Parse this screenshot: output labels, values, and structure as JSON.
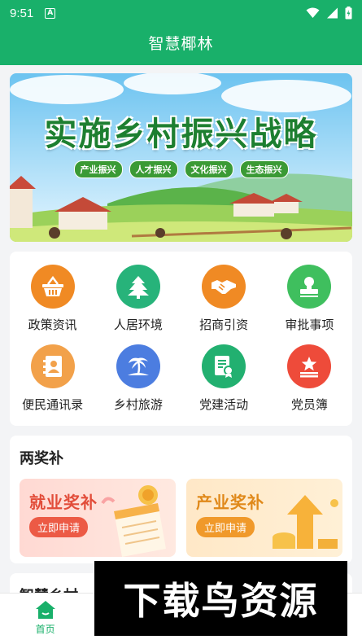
{
  "status": {
    "time": "9:51",
    "badge": "A"
  },
  "header": {
    "title": "智慧椰林"
  },
  "banner": {
    "title": "实施乡村振兴战略",
    "pills": [
      "产业振兴",
      "人才振兴",
      "文化振兴",
      "生态振兴"
    ]
  },
  "grid": {
    "items": [
      {
        "label": "政策资讯",
        "icon": "basket-icon",
        "color": "#f08a24"
      },
      {
        "label": "人居环境",
        "icon": "tree-icon",
        "color": "#27b37a"
      },
      {
        "label": "招商引资",
        "icon": "handshake-icon",
        "color": "#f08a24"
      },
      {
        "label": "审批事项",
        "icon": "stamp-icon",
        "color": "#3fbf5e"
      },
      {
        "label": "便民通讯录",
        "icon": "contacts-icon",
        "color": "#f2a14a"
      },
      {
        "label": "乡村旅游",
        "icon": "palm-island-icon",
        "color": "#4c7de0"
      },
      {
        "label": "党建活动",
        "icon": "document-badge-icon",
        "color": "#22b070"
      },
      {
        "label": "党员簿",
        "icon": "star-book-icon",
        "color": "#ee4b3a"
      }
    ]
  },
  "rewards": {
    "heading": "两奖补",
    "employment": {
      "title": "就业奖补",
      "apply": "立即申请"
    },
    "industry": {
      "title": "产业奖补",
      "apply": "立即申请"
    }
  },
  "next_section": {
    "heading": "智慧乡村"
  },
  "tabbar": {
    "tabs": [
      {
        "label": "首页"
      }
    ]
  },
  "watermark": {
    "text": "下载鸟资源"
  },
  "colors": {
    "primary": "#19b06a"
  }
}
